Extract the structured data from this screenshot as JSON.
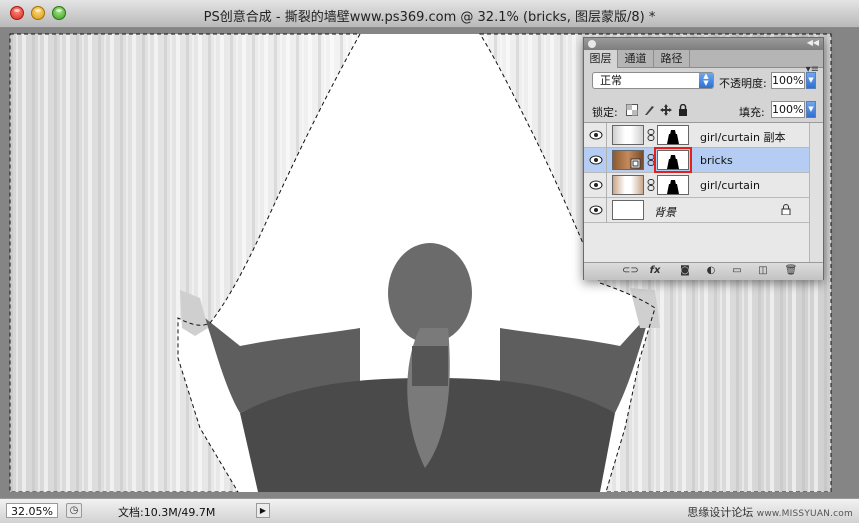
{
  "window": {
    "title": "PS创意合成 - 撕裂的墙壁www.ps369.com @ 32.1% (bricks, 图层蒙版/8) *"
  },
  "status_bar": {
    "zoom": "32.05%",
    "doc_info": "文档:10.3M/49.7M",
    "watermark": "思缘设计论坛",
    "watermark_url": "www.MISSYUAN.com"
  },
  "layers_panel": {
    "tabs": [
      {
        "label": "图层",
        "active": true
      },
      {
        "label": "通道",
        "active": false
      },
      {
        "label": "路径",
        "active": false
      }
    ],
    "blend_mode": "正常",
    "opacity_label": "不透明度:",
    "opacity_value": "100%",
    "lock_label": "锁定:",
    "fill_label": "填充:",
    "fill_value": "100%",
    "layers": [
      {
        "name": "girl/curtain 副本",
        "visible": true,
        "selected": false
      },
      {
        "name": "bricks",
        "visible": true,
        "selected": true
      },
      {
        "name": "girl/curtain",
        "visible": true,
        "selected": false
      },
      {
        "name": "背景",
        "visible": true,
        "selected": false,
        "locked": true
      }
    ],
    "footer_icons": [
      "link-icon",
      "fx-icon",
      "mask-icon",
      "adjustment-icon",
      "folder-icon",
      "new-layer-icon",
      "trash-icon"
    ]
  },
  "colors": {
    "selection_highlight": "#b5cdf2",
    "mask_outline": "#e2201c"
  }
}
